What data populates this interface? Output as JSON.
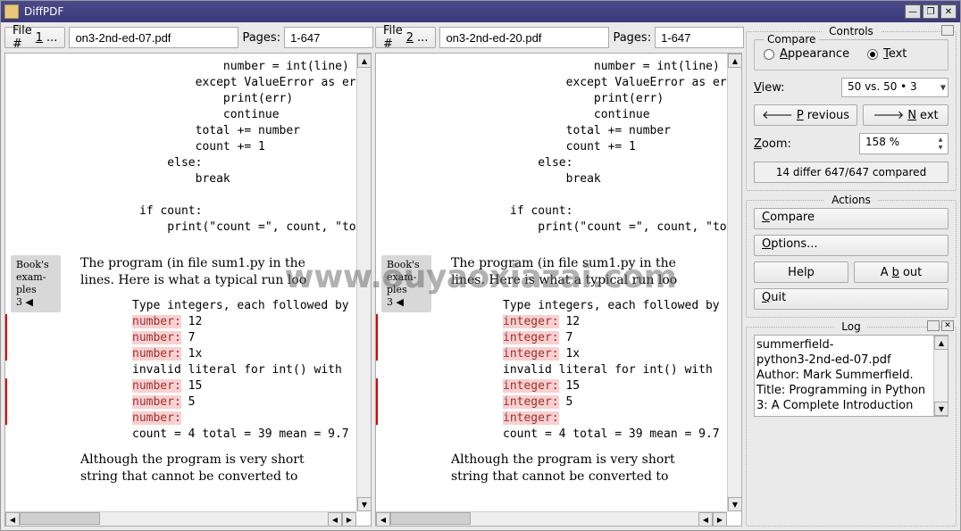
{
  "app_title": "DiffPDF",
  "file1": {
    "label": "File #1...",
    "value": "on3-2nd-ed-07.pdf",
    "pages_label": "Pages:",
    "pages_value": "1-647"
  },
  "file2": {
    "label": "File #2...",
    "value": "on3-2nd-ed-20.pdf",
    "pages_label": "Pages:",
    "pages_value": "1-647"
  },
  "doc_left": {
    "code": "            number = int(line)\n        except ValueError as er\n            print(err)\n            continue\n        total += number\n        count += 1\n    else:\n        break\n\nif count:\n    print(\"count =\", count, \"to",
    "serif1": "The program (in file sum1.py in the\nlines. Here is what a typical run loo",
    "list_head": "Type integers, each followed by",
    "items": [
      {
        "pre": "number:",
        "val": " 12"
      },
      {
        "pre": "number:",
        "val": " 7"
      },
      {
        "pre": "number:",
        "val": " 1x"
      }
    ],
    "invalid": "invalid literal for int() with",
    "items2": [
      {
        "pre": "number:",
        "val": " 15"
      },
      {
        "pre": "number:",
        "val": " 5"
      },
      {
        "pre": "number:",
        "val": ""
      }
    ],
    "count_line": "count = 4 total = 39 mean = 9.7",
    "serif2": "Although the program is very short\nstring that cannot be converted to",
    "note": {
      "l1": "Book's",
      "l2": "exam-",
      "l3": "ples",
      "l4": "3 ◀"
    }
  },
  "doc_right": {
    "code": "            number = int(line)\n        except ValueError as er\n            print(err)\n            continue\n        total += number\n        count += 1\n    else:\n        break\n\nif count:\n    print(\"count =\", count, \"to",
    "serif1": "The program (in file sum1.py in the\nlines. Here is what a typical run loo",
    "list_head": "Type integers, each followed by",
    "items": [
      {
        "pre": "integer:",
        "val": " 12"
      },
      {
        "pre": "integer:",
        "val": " 7"
      },
      {
        "pre": "integer:",
        "val": " 1x"
      }
    ],
    "invalid": "invalid literal for int() with",
    "items2": [
      {
        "pre": "integer:",
        "val": " 15"
      },
      {
        "pre": "integer:",
        "val": " 5"
      },
      {
        "pre": "integer:",
        "val": ""
      }
    ],
    "count_line": "count = 4 total = 39 mean = 9.7",
    "serif2": "Although the program is very short\nstring that cannot be converted to",
    "note": {
      "l1": "Book's",
      "l2": "exam-",
      "l3": "ples",
      "l4": "3 ◀"
    }
  },
  "controls": {
    "title": "Controls",
    "compare_group": "Compare",
    "radio_appearance": "Appearance",
    "radio_text": "Text",
    "view_label": "View:",
    "view_value": "50 vs. 50 • 3",
    "prev": "Previous",
    "next": "Next",
    "zoom_label": "Zoom:",
    "zoom_value": "158 %",
    "status": "14 differ 647/647 compared"
  },
  "actions": {
    "title": "Actions",
    "compare": "Compare",
    "options": "Options...",
    "help": "Help",
    "about": "About",
    "quit": "Quit"
  },
  "log": {
    "title": "Log",
    "content": "summerfield-\npython3-2nd-ed-07.pdf\nAuthor: Mark Summerfield.\nTitle: Programming in Python\n3: A Complete Introduction"
  },
  "watermark": "www.ouyaoxiazai.com"
}
